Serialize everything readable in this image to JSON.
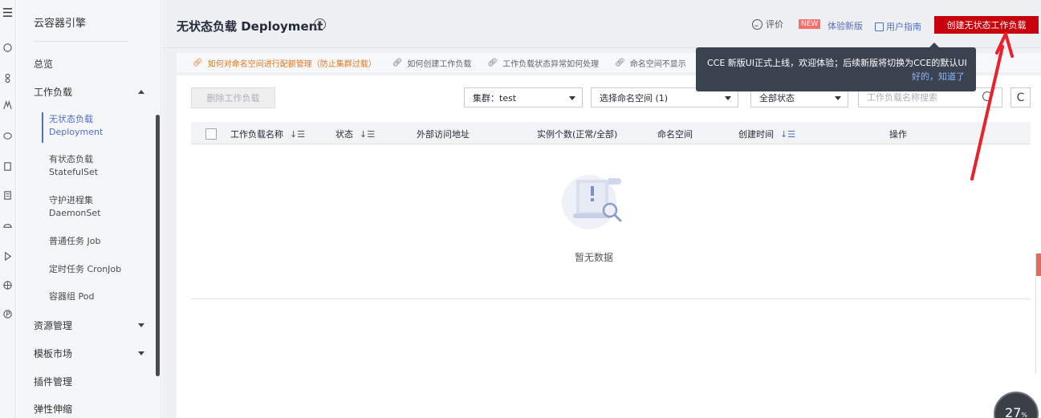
{
  "sidebar": {
    "brand": "云容器引擎",
    "items": [
      {
        "label": "总览"
      },
      {
        "label": "工作负载"
      },
      {
        "label": "资源管理"
      },
      {
        "label": "模板市场"
      },
      {
        "label": "插件管理"
      },
      {
        "label": "弹性伸缩"
      }
    ],
    "sub_items": [
      {
        "line1": "无状态负载",
        "line2": "Deployment"
      },
      {
        "line1": "有状态负载",
        "line2": "StatefulSet"
      },
      {
        "line1": "守护进程集",
        "line2": "DaemonSet"
      },
      {
        "line1": "普通任务 Job",
        "line2": ""
      },
      {
        "line1": "定时任务 CronJob",
        "line2": ""
      },
      {
        "line1": "容器组 Pod",
        "line2": ""
      }
    ]
  },
  "header": {
    "title": "无状态负载 Deployment",
    "help_glyph": "?",
    "rate_label": "评价",
    "new_badge": "NEW",
    "try_new_label": "体验新版",
    "guide_label": "用户指南",
    "create_button": "创建无状态工作负载"
  },
  "help_links": [
    "如何对命名空间进行配额管理（防止集群过载）",
    "如何创建工作负载",
    "工作负载状态异常如何处理",
    "命名空间不显示"
  ],
  "toolbar": {
    "delete_button": "删除工作负载",
    "cluster_select": "集群：test",
    "namespace_select": "选择命名空间 (1)",
    "status_select": "全部状态",
    "search_placeholder": "工作负载名称搜索",
    "refresh_glyph": "C"
  },
  "table": {
    "columns": [
      "工作负载名称",
      "状态",
      "外部访问地址",
      "实例个数(正常/全部)",
      "命名空间",
      "创建时间",
      "操作"
    ],
    "sort_glyph": "↓☰",
    "empty_text": "暂无数据"
  },
  "tooltip": {
    "text": "CCE 新版UI正式上线，欢迎体验；后续新版将切换为CCE的默认UI",
    "link": "好的，知道了"
  },
  "progress_badge": {
    "value": "27",
    "unit": "%"
  },
  "colors": {
    "accent": "#526ecc",
    "brand_red": "#c7000b",
    "warning_link": "#e5761e",
    "annotation_arrow": "#e8212b"
  }
}
